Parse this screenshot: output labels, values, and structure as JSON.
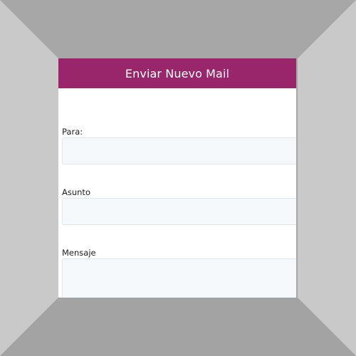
{
  "modal": {
    "title": "Enviar Nuevo Mail",
    "header_color": "#99266b"
  },
  "form": {
    "fields": [
      {
        "label": "Para:",
        "value": "",
        "type": "text"
      },
      {
        "label": "Asunto",
        "value": "",
        "type": "text"
      },
      {
        "label": "Mensaje",
        "value": "",
        "type": "textarea"
      }
    ]
  }
}
